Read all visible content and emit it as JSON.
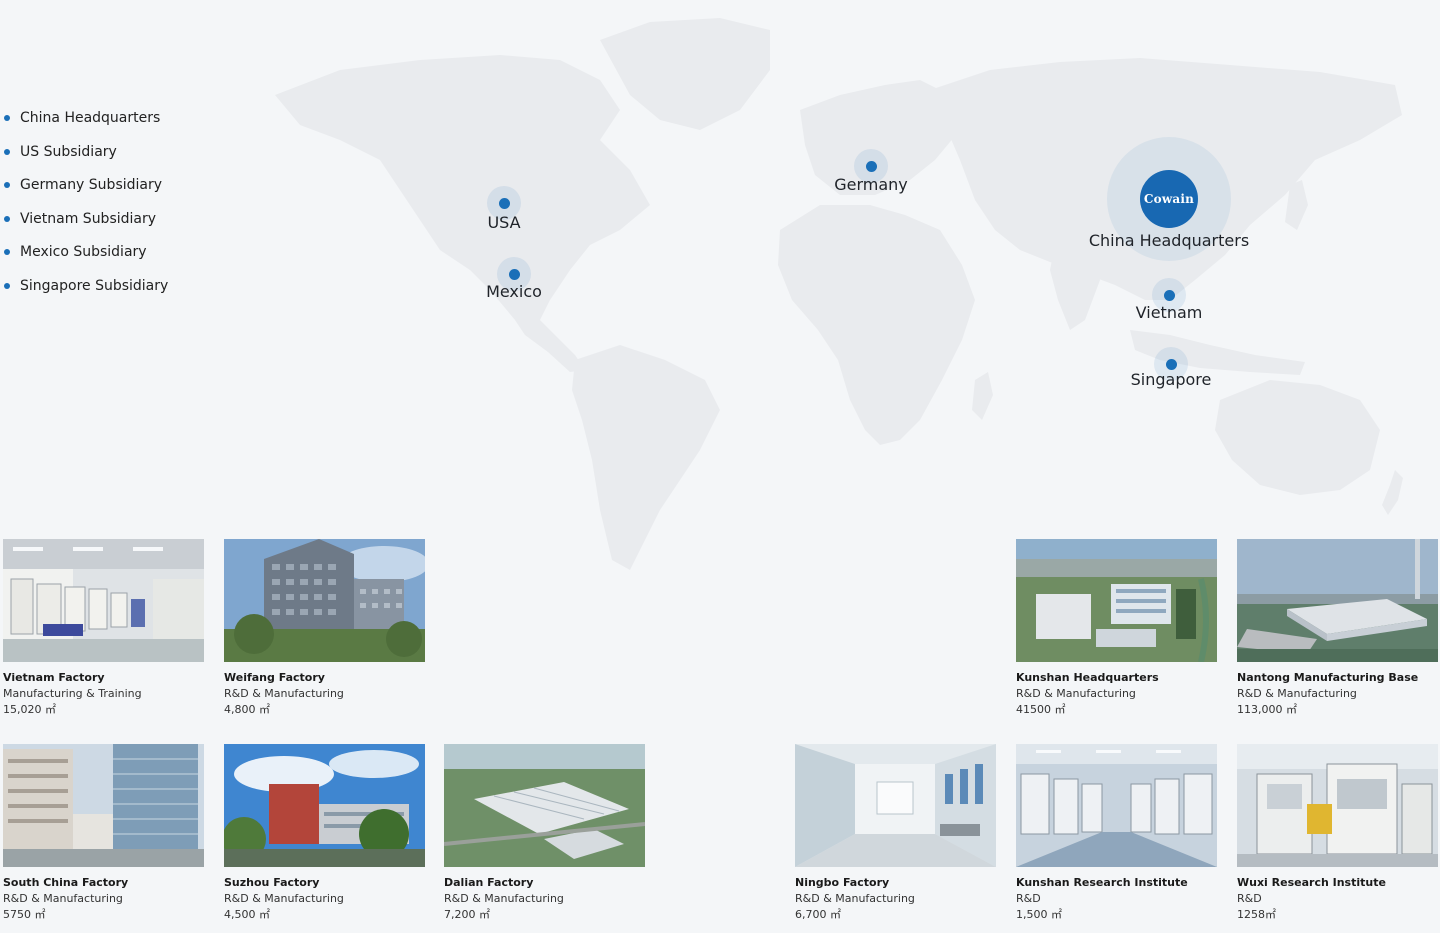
{
  "legend": {
    "items": [
      {
        "label": "China Headquarters"
      },
      {
        "label": "US Subsidiary"
      },
      {
        "label": "Germany Subsidiary"
      },
      {
        "label": "Vietnam Subsidiary"
      },
      {
        "label": "Mexico Subsidiary"
      },
      {
        "label": "Singapore Subsidiary"
      }
    ]
  },
  "map": {
    "markers": {
      "usa": {
        "label": "USA"
      },
      "mexico": {
        "label": "Mexico"
      },
      "germany": {
        "label": "Germany"
      },
      "china": {
        "label": "China Headquarters",
        "logo": "Cowain"
      },
      "vietnam": {
        "label": "Vietnam"
      },
      "singapore": {
        "label": "Singapore"
      }
    },
    "marker_color": "#1a6fb8"
  },
  "facilities": [
    {
      "name": "Vietnam Factory",
      "type": "Manufacturing & Training",
      "area": "15,020 ㎡"
    },
    {
      "name": "Weifang Factory",
      "type": "R&D & Manufacturing",
      "area": "4,800 ㎡"
    },
    {
      "name": "Kunshan Headquarters",
      "type": "R&D & Manufacturing",
      "area": "41500 ㎡"
    },
    {
      "name": "Nantong Manufacturing Base",
      "type": "R&D & Manufacturing",
      "area": "113,000 ㎡"
    },
    {
      "name": "South China Factory",
      "type": "R&D & Manufacturing",
      "area": "5750 ㎡"
    },
    {
      "name": "Suzhou Factory",
      "type": "R&D & Manufacturing",
      "area": "4,500 ㎡"
    },
    {
      "name": "Dalian Factory",
      "type": "R&D & Manufacturing",
      "area": "7,200 ㎡"
    },
    {
      "name": "Ningbo Factory",
      "type": "R&D & Manufacturing",
      "area": "6,700 ㎡"
    },
    {
      "name": "Kunshan Research Institute",
      "type": "R&D",
      "area": "1,500 ㎡"
    },
    {
      "name": "Wuxi Research Institute",
      "type": "R&D",
      "area": "1258㎡"
    }
  ]
}
